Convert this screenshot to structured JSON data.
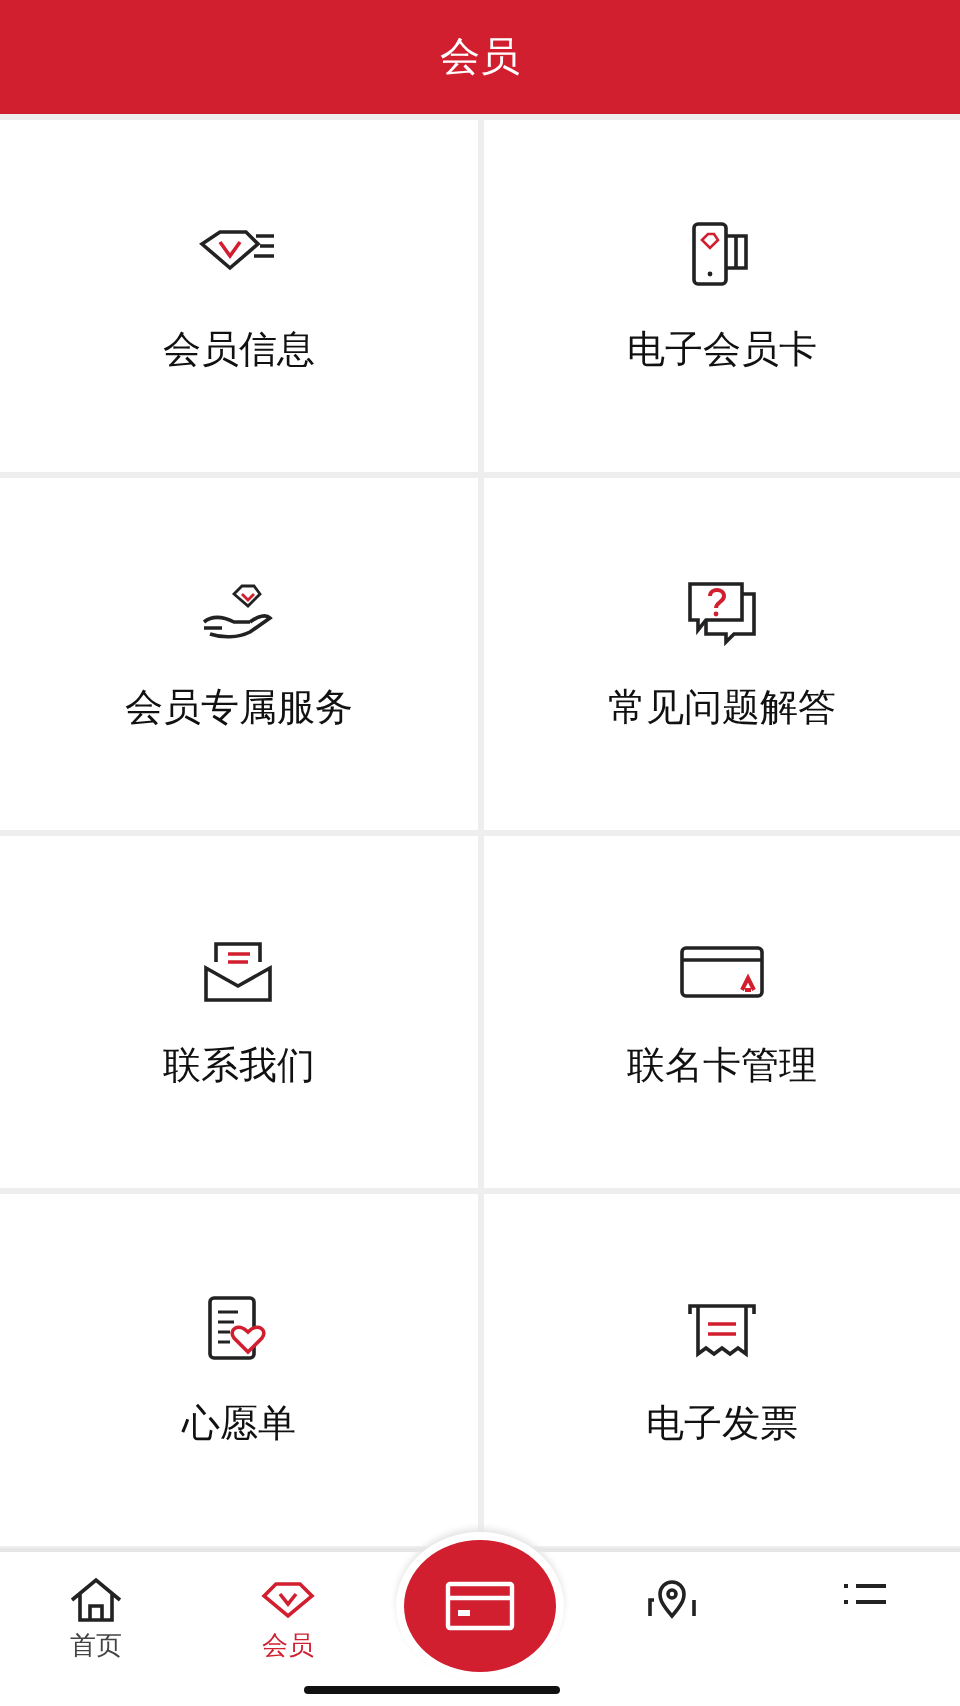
{
  "header": {
    "title": "会员"
  },
  "menu": [
    {
      "label": "会员信息",
      "kind": "info"
    },
    {
      "label": "电子会员卡",
      "kind": "ecard"
    },
    {
      "label": "会员专属服务",
      "kind": "service"
    },
    {
      "label": "常见问题解答",
      "kind": "faq"
    },
    {
      "label": "联系我们",
      "kind": "contact"
    },
    {
      "label": "联名卡管理",
      "kind": "cobrand"
    },
    {
      "label": "心愿单",
      "kind": "wish"
    },
    {
      "label": "电子发票",
      "kind": "invoice"
    }
  ],
  "tab_bar": [
    {
      "kind": "home",
      "label": "首页",
      "selected": false
    },
    {
      "kind": "member",
      "label": "会员",
      "selected": true
    },
    {
      "kind": "card",
      "selected": false
    },
    {
      "kind": "location",
      "selected": false
    },
    {
      "kind": "list",
      "selected": false
    }
  ]
}
